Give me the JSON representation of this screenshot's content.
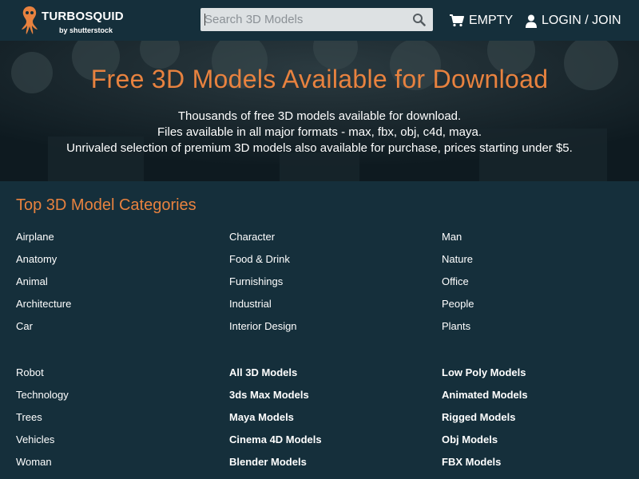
{
  "header": {
    "logo_text": "TURBOSQUID",
    "logo_sub": "by shutterstock",
    "search_placeholder": "Search 3D Models",
    "search_icon": "search-icon",
    "cart_label": "EMPTY",
    "login_label": "LOGIN / JOIN",
    "brand_color": "#e8823f",
    "bg_color": "#152f3b"
  },
  "hero": {
    "title": "Free 3D Models Available for Download",
    "line1": "Thousands of free 3D models available for download.",
    "line2": "Files available in all major formats - max, fbx, obj, c4d, maya.",
    "line3": "Unrivaled selection of premium 3D models also available for purchase, prices starting under $5."
  },
  "categories": {
    "title": "Top 3D Model Categories",
    "col1": [
      "Airplane",
      "Anatomy",
      "Animal",
      "Architecture",
      "Car",
      "Robot",
      "Technology",
      "Trees",
      "Vehicles",
      "Woman"
    ],
    "col2": [
      "Character",
      "Food & Drink",
      "Furnishings",
      "Industrial",
      "Interior Design",
      "All 3D Models",
      "3ds Max Models",
      "Maya Models",
      "Cinema 4D Models",
      "Blender Models"
    ],
    "col3": [
      "Man",
      "Nature",
      "Office",
      "People",
      "Plants",
      "Low Poly Models",
      "Animated Models",
      "Rigged Models",
      "Obj Models",
      "FBX Models"
    ]
  }
}
